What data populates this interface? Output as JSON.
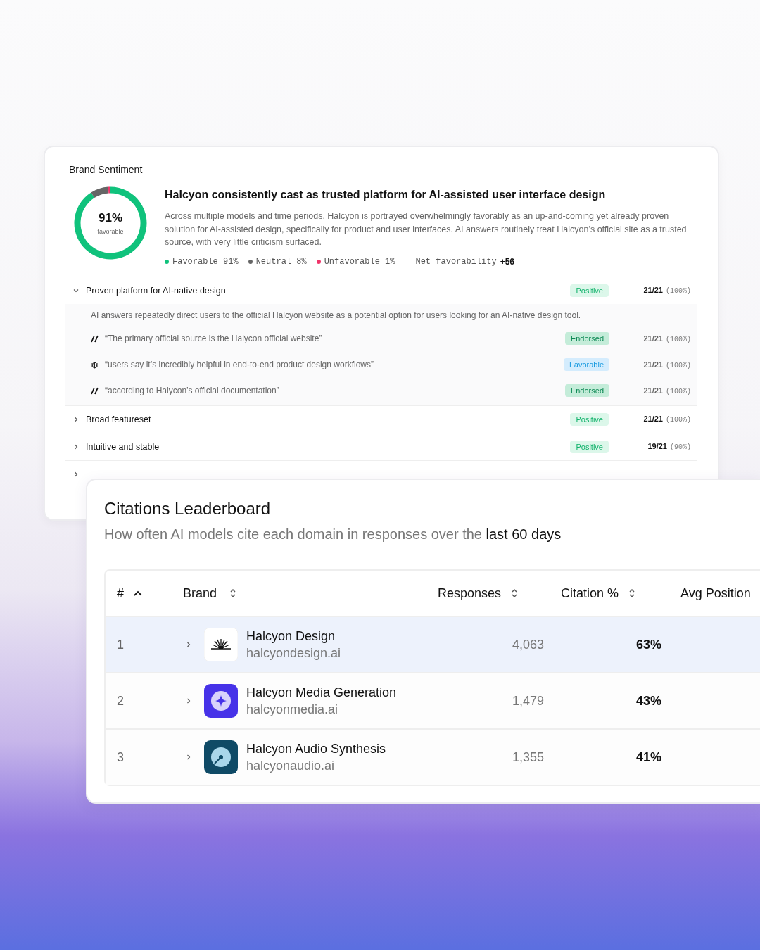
{
  "sentiment": {
    "title": "Brand Sentiment",
    "donut": {
      "value": "91%",
      "caption": "favorable",
      "chart_data": {
        "type": "donut",
        "values": [
          91,
          8,
          1
        ]
      }
    },
    "headline": "Halcyon consistently cast as trusted platform for AI-assisted user interface design",
    "summary": "Across multiple models and time periods, Halcyon is portrayed overwhelmingly favorably as an up-and-coming yet already proven solution for AI-assisted design, specifically for product and user interfaces. AI answers routinely treat Halcyon’s official site as a trusted source, with very little criticism surfaced.",
    "legend": [
      {
        "label": "Favorable 91%",
        "color": "#10c27c"
      },
      {
        "label": "Neutral 8%",
        "color": "#666666"
      },
      {
        "label": "Unfavorable 1%",
        "color": "#f0346a"
      }
    ],
    "net": {
      "label": "Net favorability",
      "value": "+56"
    },
    "topics": [
      {
        "label": "Proven platform for AI-native design",
        "expanded": true,
        "badge": {
          "kind": "positive",
          "text": "Positive"
        },
        "count": "21/21",
        "pct": "(100%)",
        "detail": "AI answers repeatedly direct users to the official Halcyon website as a potential option for users looking for an AI-native design tool.",
        "quotes": [
          {
            "kind": "slash",
            "text": "“The primary official source is the Halycon official website”",
            "badge": {
              "kind": "endorsed",
              "text": "Endorsed"
            },
            "count": "21/21",
            "pct": "(100%)"
          },
          {
            "kind": "bug",
            "text": "“users say it’s incredibly helpful in end-to-end product design workflows”",
            "badge": {
              "kind": "favorable",
              "text": "Favorable"
            },
            "count": "21/21",
            "pct": "(100%)"
          },
          {
            "kind": "slash",
            "text": "“according to Halycon’s official documentation”",
            "badge": {
              "kind": "endorsed",
              "text": "Endorsed"
            },
            "count": "21/21",
            "pct": "(100%)"
          }
        ]
      },
      {
        "label": "Broad featureset",
        "expanded": false,
        "badge": {
          "kind": "positive",
          "text": "Positive"
        },
        "count": "21/21",
        "pct": "(100%)"
      },
      {
        "label": "Intuitive and stable",
        "expanded": false,
        "badge": {
          "kind": "positive",
          "text": "Positive"
        },
        "count": "19/21",
        "pct": "(90%)"
      },
      {
        "expanded": false
      }
    ]
  },
  "leaderboard": {
    "title": "Citations Leaderboard",
    "subtitle": "How often AI models cite each domain in responses over the **last 60 days**",
    "columns": [
      {
        "label": "#",
        "sorted_ascending": true
      },
      {
        "label": "Brand",
        "sorted_ascending": false
      },
      {
        "label": "Responses",
        "sorted_ascending": false
      },
      {
        "label": "Citation %",
        "sorted_ascending": false
      },
      {
        "label": "Avg Position"
      }
    ],
    "rows": [
      {
        "rank": "1",
        "kind": "burst",
        "name": "Halcyon Design",
        "domain": "halcyondesign.ai",
        "responses": "4,063",
        "citation": "63%",
        "selected": true
      },
      {
        "rank": "2",
        "kind": "sparkle",
        "name": "Halcyon Media Generation",
        "domain": "halcyonmedia.ai",
        "responses": "1,479",
        "citation": "43%",
        "selected": false
      },
      {
        "rank": "3",
        "kind": "dial",
        "name": "Halcyon Audio Synthesis",
        "domain": "halcyonaudio.ai",
        "responses": "1,355",
        "citation": "41%",
        "selected": false
      }
    ]
  }
}
